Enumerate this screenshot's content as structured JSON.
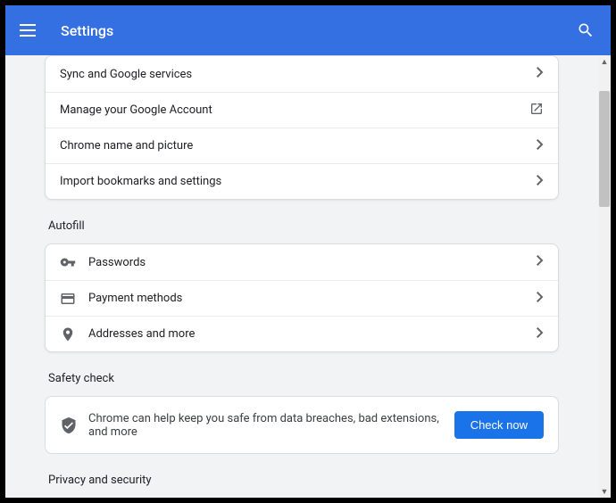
{
  "header": {
    "title": "Settings"
  },
  "top_card": {
    "items": [
      {
        "label": "Sync and Google services",
        "arrow": "chevron"
      },
      {
        "label": "Manage your Google Account",
        "arrow": "external"
      },
      {
        "label": "Chrome name and picture",
        "arrow": "chevron"
      },
      {
        "label": "Import bookmarks and settings",
        "arrow": "chevron"
      }
    ]
  },
  "autofill": {
    "title": "Autofill",
    "items": [
      {
        "label": "Passwords"
      },
      {
        "label": "Payment methods"
      },
      {
        "label": "Addresses and more"
      }
    ]
  },
  "safety": {
    "title": "Safety check",
    "message": "Chrome can help keep you safe from data breaches, bad extensions, and more",
    "button": "Check now"
  },
  "privacy": {
    "title": "Privacy and security"
  }
}
